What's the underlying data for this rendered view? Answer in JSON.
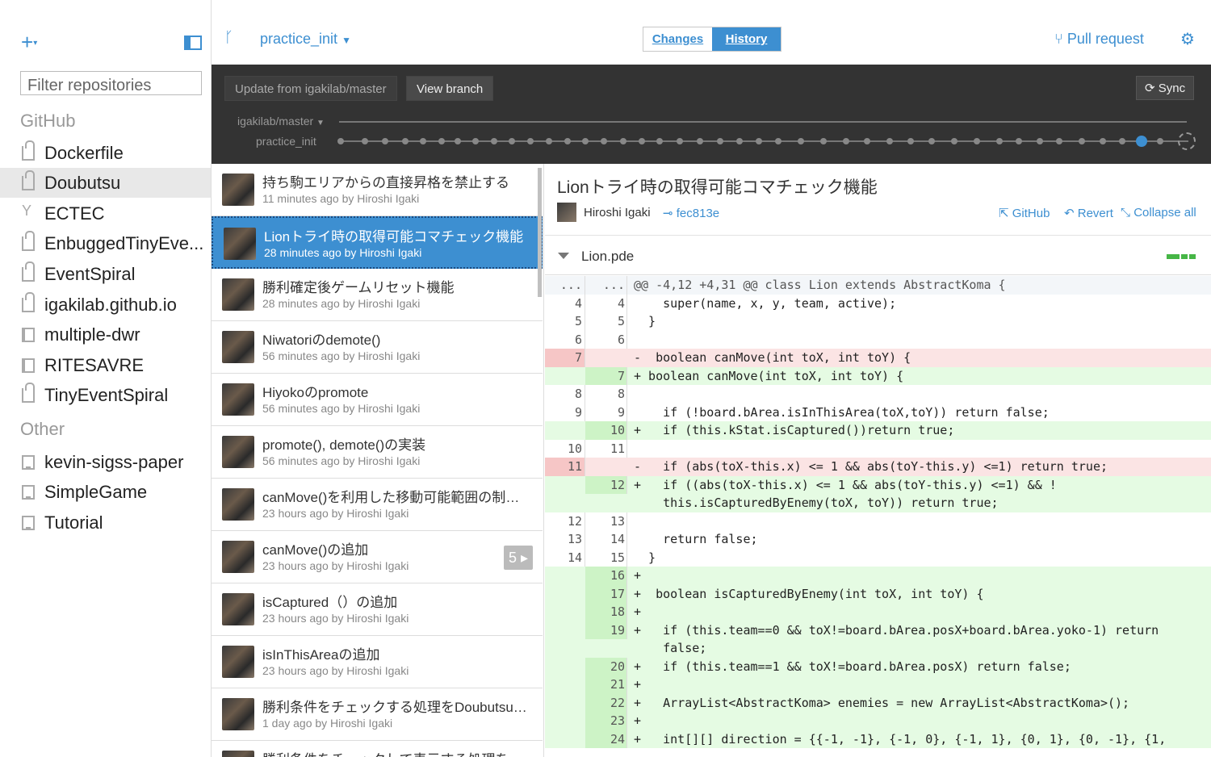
{
  "window": {
    "minimize": "—",
    "maximize": "☐",
    "close": "✕"
  },
  "sidebar": {
    "add_label": "+",
    "filter_placeholder": "Filter repositories",
    "groups": [
      {
        "name": "GitHub",
        "repos": [
          "Dockerfile",
          "Doubutsu",
          "ECTEC",
          "EnbuggedTinyEve...",
          "EventSpiral",
          "igakilab.github.io",
          "multiple-dwr",
          "RITESAVRE",
          "TinyEventSpiral"
        ]
      },
      {
        "name": "Other",
        "repos": [
          "kevin-sigss-paper",
          "SimpleGame",
          "Tutorial"
        ]
      }
    ],
    "selected_repo": "Doubutsu"
  },
  "toolbar": {
    "branch": "practice_init",
    "tab_changes": "Changes",
    "tab_history": "History",
    "pull_request": "Pull request"
  },
  "branchbar": {
    "update_btn": "Update from igakilab/master",
    "view_btn": "View branch",
    "sync_btn": "Sync",
    "master_label": "igakilab/master",
    "branch_label": "practice_init"
  },
  "commits": [
    {
      "title": "持ち駒エリアからの直接昇格を禁止する",
      "meta": "11 minutes ago by Hiroshi Igaki"
    },
    {
      "title": "Lionトライ時の取得可能コマチェック機能",
      "meta": "28 minutes ago by Hiroshi Igaki"
    },
    {
      "title": "勝利確定後ゲームリセット機能",
      "meta": "28 minutes ago by Hiroshi Igaki"
    },
    {
      "title": "Niwatoriのdemote()",
      "meta": "56 minutes ago by Hiroshi Igaki"
    },
    {
      "title": "Hiyokoのpromote",
      "meta": "56 minutes ago by Hiroshi Igaki"
    },
    {
      "title": "promote(), demote()の実装",
      "meta": "56 minutes ago by Hiroshi Igaki"
    },
    {
      "title": "canMove()を利用した移動可能範囲の制約...",
      "meta": "23 hours ago by Hiroshi Igaki"
    },
    {
      "title": "canMove()の追加",
      "meta": "23 hours ago by Hiroshi Igaki",
      "badge": "5 ▸"
    },
    {
      "title": "isCaptured（）の追加",
      "meta": "23 hours ago by Hiroshi Igaki"
    },
    {
      "title": "isInThisAreaの追加",
      "meta": "23 hours ago by Hiroshi Igaki"
    },
    {
      "title": "勝利条件をチェックする処理をDoubutsu.pde...",
      "meta": "1 day ago by Hiroshi Igaki"
    },
    {
      "title": "勝利条件をチェックして表示する処理をLi...",
      "meta": ""
    }
  ],
  "detail": {
    "title": "Lionトライ時の取得可能コマチェック機能",
    "author": "Hiroshi Igaki",
    "sha": "fec813e",
    "github": "GitHub",
    "revert": "Revert",
    "collapse": "Collapse all",
    "file": "Lion.pde"
  },
  "diff": [
    {
      "t": "hunk",
      "o": "...",
      "n": "...",
      "c": "@@ -4,12 +4,31 @@ class Lion extends AbstractKoma {"
    },
    {
      "t": "ctx",
      "o": "4",
      "n": "4",
      "c": "    super(name, x, y, team, active);"
    },
    {
      "t": "ctx",
      "o": "5",
      "n": "5",
      "c": "  }"
    },
    {
      "t": "ctx",
      "o": "6",
      "n": "6",
      "c": ""
    },
    {
      "t": "del",
      "o": "7",
      "n": "",
      "c": "-  boolean canMove(int toX, int toY) {"
    },
    {
      "t": "add",
      "o": "",
      "n": "7",
      "c": "+ boolean canMove(int toX, int toY) {"
    },
    {
      "t": "ctx",
      "o": "8",
      "n": "8",
      "c": ""
    },
    {
      "t": "ctx",
      "o": "9",
      "n": "9",
      "c": "    if (!board.bArea.isInThisArea(toX,toY)) return false;"
    },
    {
      "t": "add",
      "o": "",
      "n": "10",
      "c": "+   if (this.kStat.isCaptured())return true;"
    },
    {
      "t": "ctx",
      "o": "10",
      "n": "11",
      "c": ""
    },
    {
      "t": "del",
      "o": "11",
      "n": "",
      "c": "-   if (abs(toX-this.x) <= 1 && abs(toY-this.y) <=1) return true;"
    },
    {
      "t": "add",
      "o": "",
      "n": "12",
      "c": "+   if ((abs(toX-this.x) <= 1 && abs(toY-this.y) <=1) && !"
    },
    {
      "t": "add",
      "o": "",
      "n": "",
      "c": "    this.isCapturedByEnemy(toX, toY)) return true;"
    },
    {
      "t": "ctx",
      "o": "12",
      "n": "13",
      "c": ""
    },
    {
      "t": "ctx",
      "o": "13",
      "n": "14",
      "c": "    return false;"
    },
    {
      "t": "ctx",
      "o": "14",
      "n": "15",
      "c": "  }"
    },
    {
      "t": "add",
      "o": "",
      "n": "16",
      "c": "+"
    },
    {
      "t": "add",
      "o": "",
      "n": "17",
      "c": "+  boolean isCapturedByEnemy(int toX, int toY) {"
    },
    {
      "t": "add",
      "o": "",
      "n": "18",
      "c": "+"
    },
    {
      "t": "add",
      "o": "",
      "n": "19",
      "c": "+   if (this.team==0 && toX!=board.bArea.posX+board.bArea.yoko-1) return"
    },
    {
      "t": "add",
      "o": "",
      "n": "",
      "c": "    false;"
    },
    {
      "t": "add",
      "o": "",
      "n": "20",
      "c": "+   if (this.team==1 && toX!=board.bArea.posX) return false;"
    },
    {
      "t": "add",
      "o": "",
      "n": "21",
      "c": "+"
    },
    {
      "t": "add",
      "o": "",
      "n": "22",
      "c": "+   ArrayList<AbstractKoma> enemies = new ArrayList<AbstractKoma>();"
    },
    {
      "t": "add",
      "o": "",
      "n": "23",
      "c": "+"
    },
    {
      "t": "add",
      "o": "",
      "n": "24",
      "c": "+   int[][] direction = {{-1, -1}, {-1, 0}, {-1, 1}, {0, 1}, {0, -1}, {1,"
    }
  ],
  "colors": {
    "accent": "#3d8fd1",
    "dark_bar": "#333333",
    "add_bg": "#e5fbe3",
    "del_bg": "#fbe4e4"
  }
}
